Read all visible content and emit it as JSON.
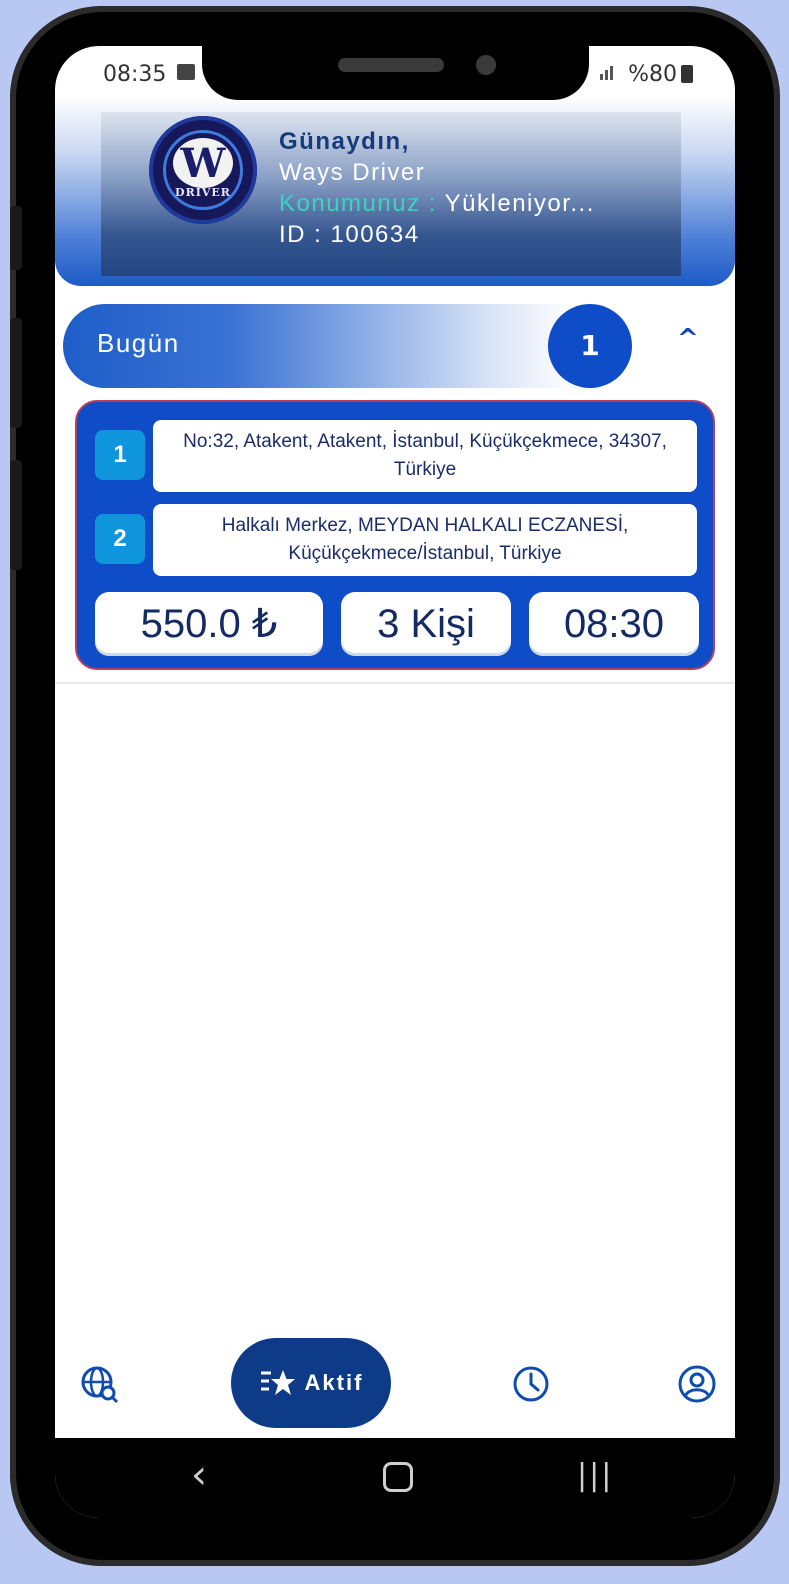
{
  "status_bar": {
    "time": "08:35",
    "battery": "%80"
  },
  "header": {
    "greeting": "Günaydın,",
    "driver_name": "Ways Driver",
    "location_label": "Konumunuz :",
    "location_value": "Yükleniyor...",
    "id_line": "ID : 100634",
    "logo_text": "DRIVER",
    "logo_letter": "W"
  },
  "today": {
    "label": "Bugün",
    "count": "1"
  },
  "ride": {
    "stops": [
      {
        "num": "1",
        "address": "No:32, Atakent, Atakent, İstanbul, Küçükçekmece, 34307, Türkiye"
      },
      {
        "num": "2",
        "address": "Halkalı Merkez, MEYDAN HALKALI ECZANESİ, Küçükçekmece/İstanbul, Türkiye"
      }
    ],
    "price": "550.0 ₺",
    "passengers": "3 Kişi",
    "time": "08:30"
  },
  "nav": {
    "active_label": "Aktif"
  },
  "colors": {
    "primary": "#0f4cc7",
    "dark": "#0e3b88",
    "accent": "#39d3c0",
    "card_border": "#b63e63"
  },
  "icons": [
    "globe-search-icon",
    "star-list-icon",
    "clock-icon",
    "profile-icon",
    "chevron-up-icon"
  ]
}
